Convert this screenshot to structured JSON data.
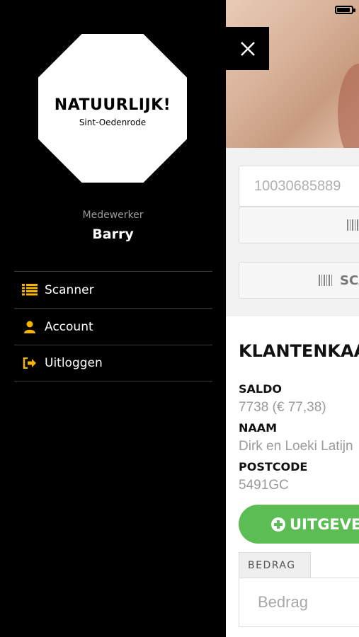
{
  "drawer": {
    "logo": {
      "title": "NATUURLIJK!",
      "subtitle": "Sint-Oedenrode"
    },
    "role": "Medewerker",
    "user_name": "Barry",
    "menu": [
      {
        "label": "Scanner",
        "icon": "list-icon"
      },
      {
        "label": "Account",
        "icon": "user-icon"
      },
      {
        "label": "Uitloggen",
        "icon": "logout-icon"
      }
    ],
    "accent_color": "#f5b400"
  },
  "main": {
    "card_number_value": "10030685889",
    "scan_button_label": "SCAN",
    "section_title": "KLANTENKAART",
    "fields": [
      {
        "label": "SALDO",
        "value": "7738 (€ 77,38)"
      },
      {
        "label": "NAAM",
        "value": "Dirk en Loeki Latijn"
      },
      {
        "label": "POSTCODE",
        "value": "5491GC"
      }
    ],
    "spend_button_label": "UITGEVEN",
    "amount_tab_label": "BEDRAG",
    "amount_placeholder": "Bedrag",
    "green_color": "#5cbd54"
  }
}
